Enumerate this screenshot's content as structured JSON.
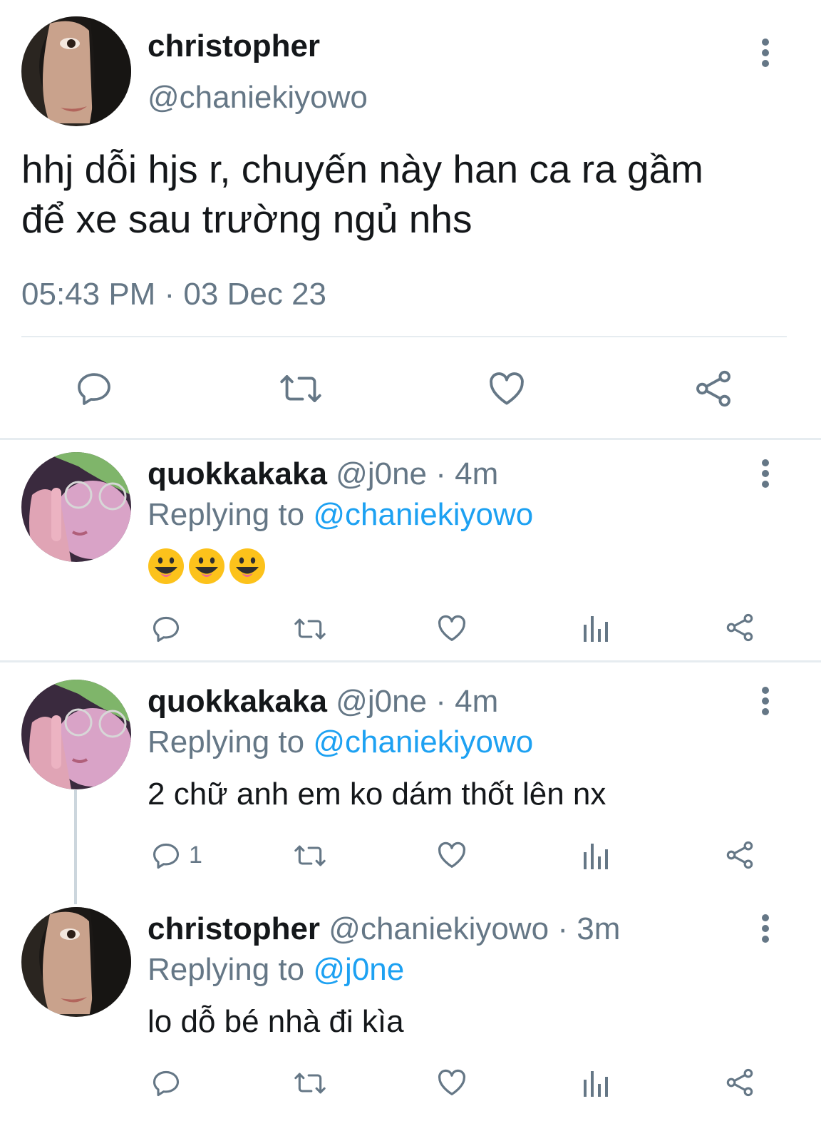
{
  "main_tweet": {
    "display_name": "christopher",
    "handle": "@chaniekiyowo",
    "text_line1": "hhj dỗi hjs r, chuyến này han ca ra gầm",
    "text_line2": "để xe sau trường ngủ nhs",
    "timestamp": "05:43 PM · 03 Dec 23"
  },
  "replies": [
    {
      "display_name": "quokkakaka",
      "handle": "@j0ne",
      "time": "· 4m",
      "replying_prefix": "Replying to",
      "replying_to": "@chaniekiyowo",
      "text": "😛😛😛",
      "reply_count": ""
    },
    {
      "display_name": "quokkakaka",
      "handle": "@j0ne",
      "time": "· 4m",
      "replying_prefix": "Replying to",
      "replying_to": "@chaniekiyowo",
      "text": "2 chữ anh em ko dám thốt lên nx",
      "reply_count": "1"
    },
    {
      "display_name": "christopher",
      "handle": "@chaniekiyowo",
      "time": "· 3m",
      "replying_prefix": "Replying to",
      "replying_to": "@j0ne",
      "text": "lo dỗ bé nhà đi kìa",
      "reply_count": ""
    }
  ],
  "icons": [
    "reply-icon",
    "retweet-icon",
    "like-icon",
    "analytics-icon",
    "share-icon",
    "more-icon"
  ],
  "colors": {
    "text": "#14171a",
    "muted": "#657786",
    "link": "#1da1f2",
    "divider": "#e6ecf0"
  }
}
